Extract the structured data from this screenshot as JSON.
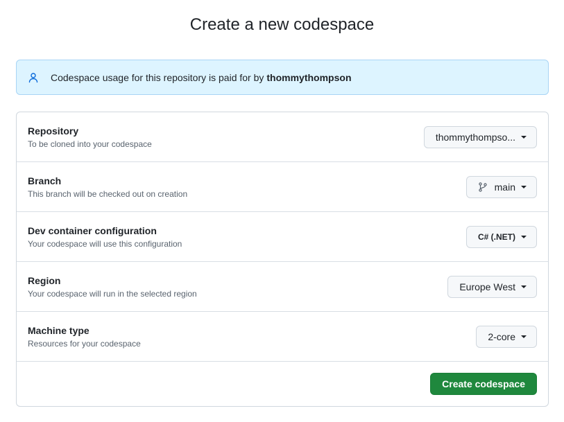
{
  "page": {
    "title": "Create a new codespace"
  },
  "banner": {
    "text": "Codespace usage for this repository is paid for by",
    "owner": "thommythompson"
  },
  "settings": [
    {
      "title": "Repository",
      "description": "To be cloned into your codespace",
      "value": "thommythompso..."
    },
    {
      "title": "Branch",
      "description": "This branch will be checked out on creation",
      "value": "main"
    },
    {
      "title": "Dev container configuration",
      "description": "Your codespace will use this configuration",
      "value": "C# (.NET)"
    },
    {
      "title": "Region",
      "description": "Your codespace will run in the selected region",
      "value": "Europe West"
    },
    {
      "title": "Machine type",
      "description": "Resources for your codespace",
      "value": "2-core"
    }
  ],
  "actions": {
    "create_label": "Create codespace"
  },
  "colors": {
    "primary_button": "#1f883d",
    "banner_bg": "#ddf4ff",
    "banner_icon": "#0969da"
  }
}
